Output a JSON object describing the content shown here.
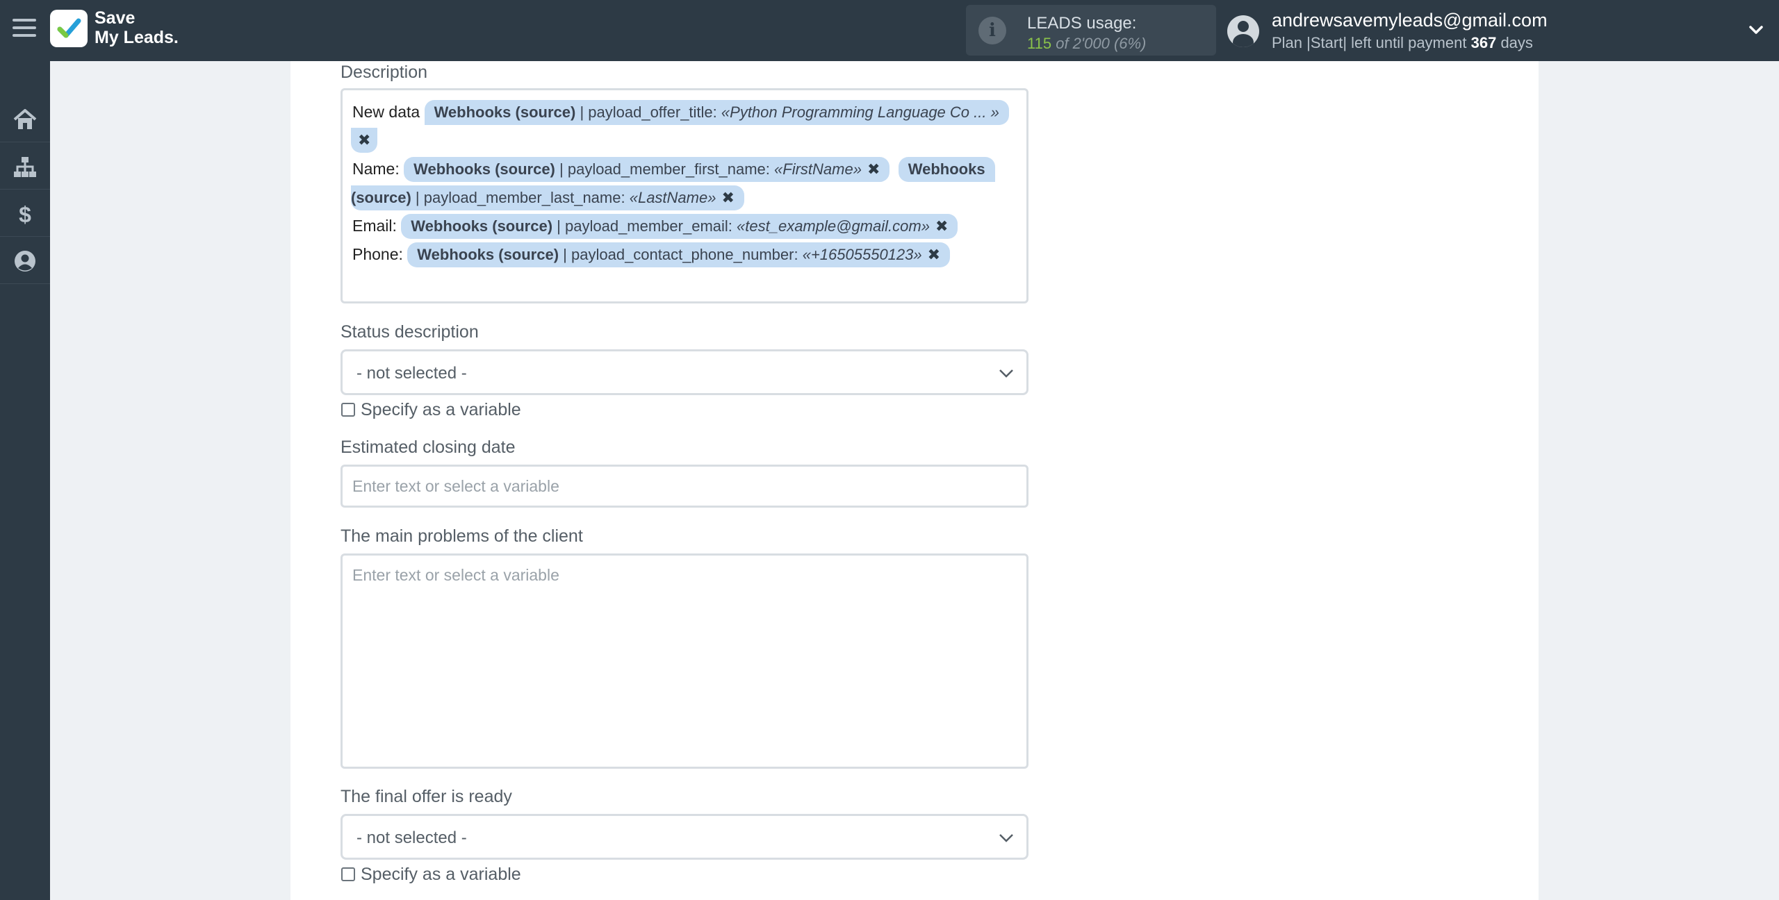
{
  "header": {
    "brand_line1": "Save",
    "brand_line2": "My Leads.",
    "usage_label": "LEADS usage:",
    "usage_used": "115",
    "usage_of": "of 2'000",
    "usage_pct": "(6%)",
    "email": "andrewsavemyleads@gmail.com",
    "plan_text": "Plan |Start| left until payment",
    "plan_days": "367",
    "plan_days_suffix": "days"
  },
  "sidebar": {
    "items": [
      {
        "icon": "home-icon"
      },
      {
        "icon": "sitemap-icon"
      },
      {
        "icon": "dollar-icon"
      },
      {
        "icon": "user-icon"
      }
    ]
  },
  "form": {
    "description": {
      "label": "Description",
      "line1_prefix": "New data",
      "tag1_source": "Webhooks (source)",
      "tag1_field": "| payload_offer_title:",
      "tag1_value": "«Python Programming Language Co ... »",
      "line2_prefix": "Name:",
      "tag2_source": "Webhooks (source)",
      "tag2_field": "| payload_member_first_name:",
      "tag2_value": "«FirstName»",
      "tag3_source_a": "Webhooks",
      "tag3_source_b": "(source)",
      "tag3_field": "| payload_member_last_name:",
      "tag3_value": "«LastName»",
      "line3_prefix": "Email:",
      "tag4_source": "Webhooks (source)",
      "tag4_field": "| payload_member_email:",
      "tag4_value": "«test_example@gmail.com»",
      "line4_prefix": "Phone:",
      "tag5_source": "Webhooks (source)",
      "tag5_field": "| payload_contact_phone_number:",
      "tag5_value": "«+16505550123»",
      "remove_glyph": "✖"
    },
    "status_description": {
      "label": "Status description",
      "value": "- not selected -",
      "checkbox_label": "Specify as a variable"
    },
    "estimated_closing_date": {
      "label": "Estimated closing date",
      "placeholder": "Enter text or select a variable"
    },
    "main_problems": {
      "label": "The main problems of the client",
      "placeholder": "Enter text or select a variable"
    },
    "final_offer": {
      "label": "The final offer is ready",
      "value": "- not selected -",
      "checkbox_label": "Specify as a variable"
    }
  }
}
